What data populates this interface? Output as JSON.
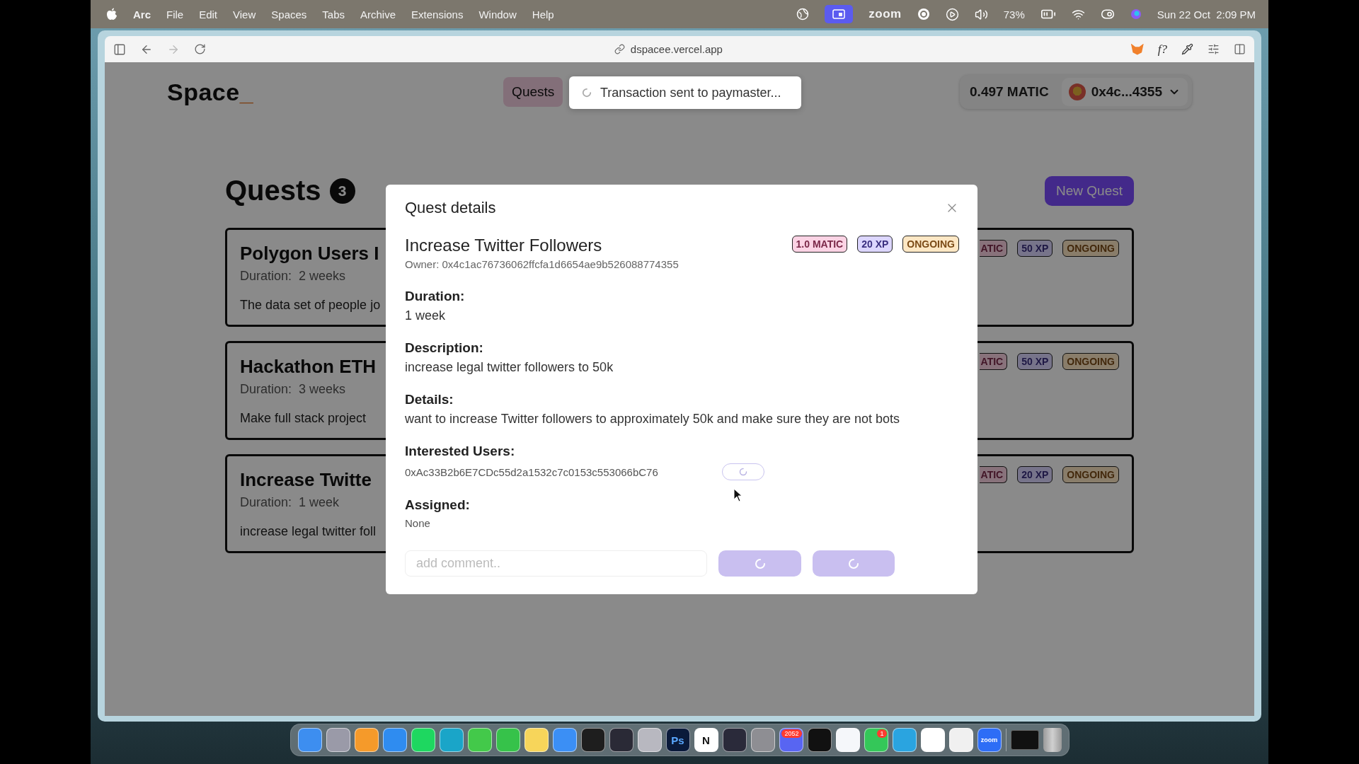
{
  "menu_bar": {
    "app": "Arc",
    "menus": [
      "File",
      "Edit",
      "View",
      "Spaces",
      "Tabs",
      "Archive",
      "Extensions",
      "Window",
      "Help"
    ],
    "zoom": "zoom",
    "battery": "73%",
    "clock": "Sun 22 Oct  2:09 PM"
  },
  "browser": {
    "url": "dspacee.vercel.app",
    "extension_label": "f?"
  },
  "header": {
    "logo": "Space",
    "logo_cursor": "_",
    "nav": [
      {
        "label": "Quests",
        "selected": true
      }
    ],
    "balance": "0.497 MATIC",
    "account": "0x4c...4355"
  },
  "toast": {
    "message": "Transaction sent to paymaster...",
    "loading": true
  },
  "page": {
    "title": "Quests",
    "count": "3",
    "new_button": "New Quest"
  },
  "quests": [
    {
      "title": "Polygon Users I",
      "duration": "Duration:  2 weeks",
      "summary": "The data set of people jo",
      "badges": [
        {
          "text": "ATIC",
          "kind": "reward"
        },
        {
          "text": "50 XP",
          "kind": "xp"
        },
        {
          "text": "ONGOING",
          "kind": "status"
        }
      ]
    },
    {
      "title": "Hackathon ETH",
      "duration": "Duration:  3 weeks",
      "summary": "Make full stack project",
      "badges": [
        {
          "text": "ATIC",
          "kind": "reward"
        },
        {
          "text": "50 XP",
          "kind": "xp"
        },
        {
          "text": "ONGOING",
          "kind": "status"
        }
      ]
    },
    {
      "title": "Increase Twitte",
      "duration": "Duration:  1 week",
      "summary": "increase legal twitter foll",
      "badges": [
        {
          "text": "ATIC",
          "kind": "reward"
        },
        {
          "text": "20 XP",
          "kind": "xp"
        },
        {
          "text": "ONGOING",
          "kind": "status"
        }
      ]
    }
  ],
  "modal": {
    "title": "Quest details",
    "quest_title": "Increase Twitter Followers",
    "owner": "Owner: 0x4c1ac76736062ffcfa1d6654ae9b526088774355",
    "badges": [
      {
        "text": "1.0 MATIC",
        "kind": "reward"
      },
      {
        "text": "20 XP",
        "kind": "xp"
      },
      {
        "text": "ONGOING",
        "kind": "status"
      }
    ],
    "sections": [
      {
        "label": "Duration:",
        "value": "1 week"
      },
      {
        "label": "Description:",
        "value": "increase legal twitter followers to 50k"
      },
      {
        "label": "Details:",
        "value": "want to increase Twitter followers to approximately 50k and make sure they are not bots"
      }
    ],
    "interested": {
      "label": "Interested Users:",
      "users": [
        {
          "address": "0xAc33B2b6E7CDc55d2a1532c7c0153c553066bC76",
          "loading": true
        }
      ]
    },
    "assigned": {
      "label": "Assigned:",
      "value": "None"
    },
    "comment": {
      "placeholder": "add comment.."
    },
    "actions": [
      {
        "loading": true
      },
      {
        "loading": true
      }
    ]
  },
  "dock": [
    {
      "color": "#3d8ef0"
    },
    {
      "color": "#9a9aa8"
    },
    {
      "color": "#f59a2a"
    },
    {
      "color": "#2f8cf0"
    },
    {
      "color": "#1ed760"
    },
    {
      "color": "#1aa5c8"
    },
    {
      "color": "#43c94a"
    },
    {
      "color": "#36c24a"
    },
    {
      "color": "#f7d55a"
    },
    {
      "color": "#3b8ff5"
    },
    {
      "color": "#1e1e1e"
    },
    {
      "color": "#2a2a36"
    },
    {
      "color": "#b8b8c0"
    },
    {
      "color": "#0a1a3a",
      "label": "Ps"
    },
    {
      "color": "#ffffff",
      "label": "N"
    },
    {
      "color": "#2a2a3a"
    },
    {
      "color": "#8e8e93"
    },
    {
      "color": "#5865f2",
      "badge": "2052"
    },
    {
      "color": "#111111"
    },
    {
      "color": "#f5f7fa"
    },
    {
      "color": "#34c759",
      "badge": "1"
    },
    {
      "color": "#2aa4e0"
    },
    {
      "color": "#ffffff"
    },
    {
      "color": "#f0f0f0"
    },
    {
      "color": "#2d6df6",
      "label": "zoom"
    }
  ]
}
